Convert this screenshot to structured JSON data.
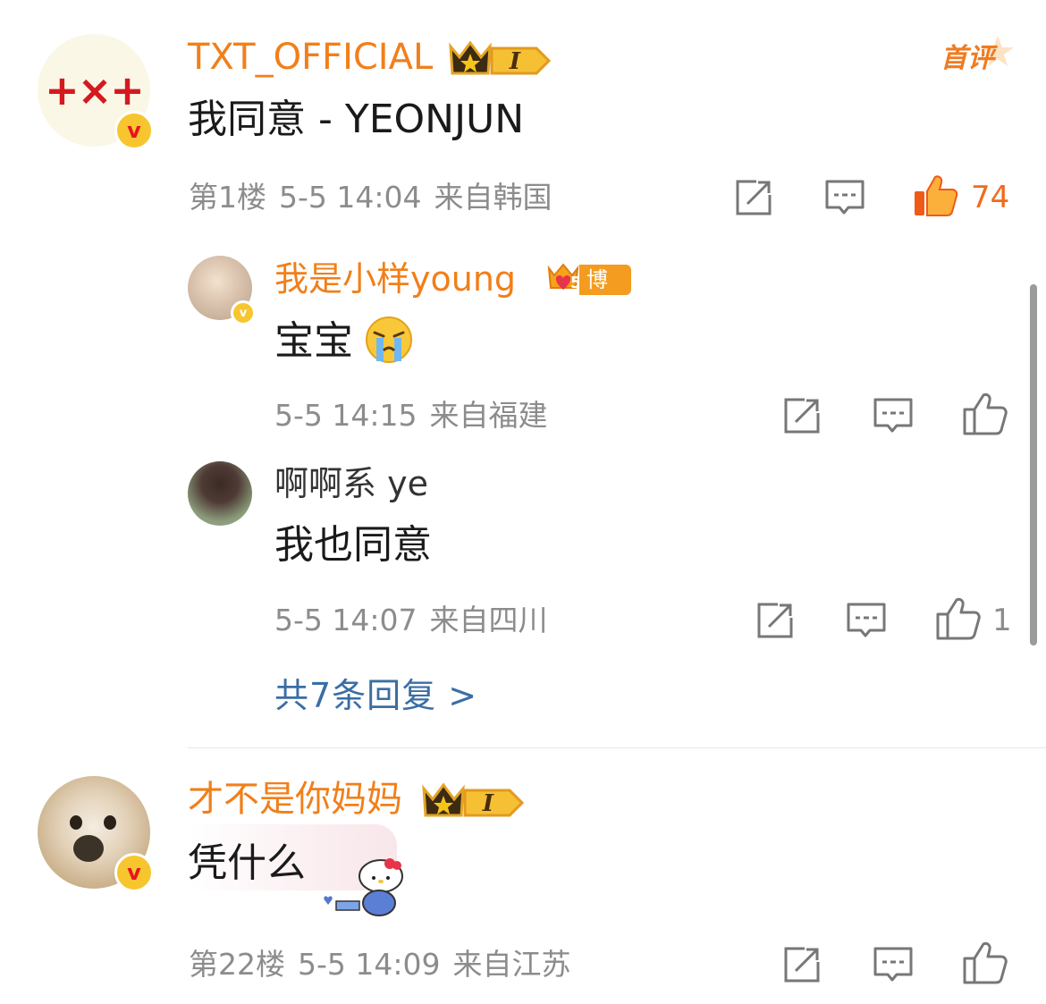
{
  "comments": [
    {
      "username": "TXT_OFFICIAL",
      "vip_badge": "I",
      "content": "我同意 - YEONJUN",
      "floor": "第1楼",
      "time": "5-5 14:04",
      "location": "来自韩国",
      "likes": "74",
      "tag": "首评",
      "logo_text": "+×+"
    },
    {
      "username": "才不是你妈妈",
      "vip_badge": "I",
      "content": "凭什么",
      "floor": "第22楼",
      "time": "5-5 14:09",
      "location": "来自江苏",
      "likes": ""
    }
  ],
  "replies": [
    {
      "username": "我是小样young",
      "badge_label": "博主",
      "badge_level": "5",
      "content": "宝宝",
      "emoji": "crying-face",
      "time": "5-5 14:15",
      "location": "来自福建",
      "likes": ""
    },
    {
      "username": "啊啊系 ye",
      "content": "我也同意",
      "time": "5-5 14:07",
      "location": "来自四川",
      "likes": "1"
    }
  ],
  "more_replies": "共7条回复 >",
  "colors": {
    "username": "#f17f1a",
    "like_active": "#f26a1b",
    "link": "#3a6ea5",
    "meta": "#8c8c8c"
  }
}
